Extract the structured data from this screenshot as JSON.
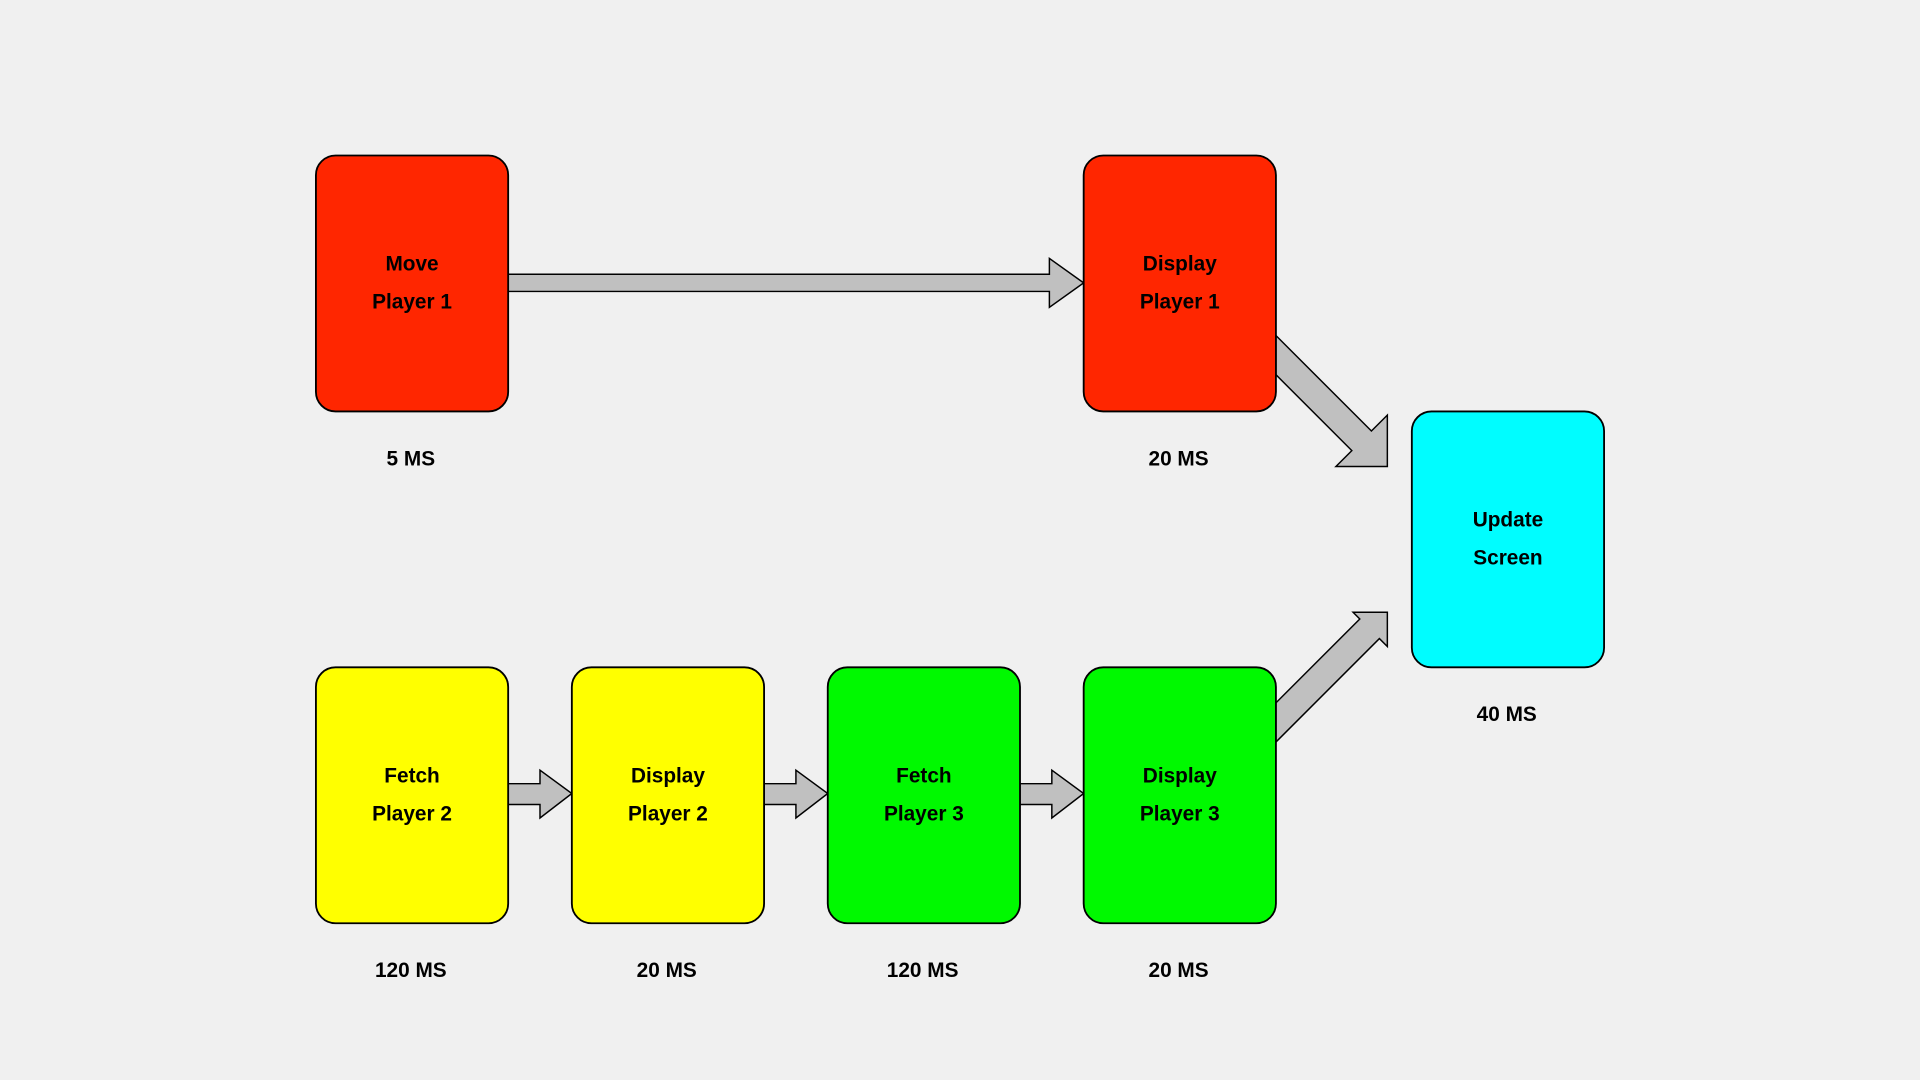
{
  "nodes": [
    {
      "id": "move-player-1",
      "lines": [
        "Move",
        "Player 1"
      ],
      "time": "5 MS",
      "color": "#ff2600"
    },
    {
      "id": "display-player-1",
      "lines": [
        "Display",
        "Player 1"
      ],
      "time": "20 MS",
      "color": "#ff2600"
    },
    {
      "id": "fetch-player-2",
      "lines": [
        "Fetch",
        "Player 2"
      ],
      "time": "120 MS",
      "color": "#ffff00"
    },
    {
      "id": "display-player-2",
      "lines": [
        "Display",
        "Player 2"
      ],
      "time": "20 MS",
      "color": "#ffff00"
    },
    {
      "id": "fetch-player-3",
      "lines": [
        "Fetch",
        "Player 3"
      ],
      "time": "120 MS",
      "color": "#00f900"
    },
    {
      "id": "display-player-3",
      "lines": [
        "Display",
        "Player 3"
      ],
      "time": "20 MS",
      "color": "#00f900"
    },
    {
      "id": "update-screen",
      "lines": [
        "Update",
        "Screen"
      ],
      "time": "40 MS",
      "color": "#00fdff"
    }
  ],
  "edges": [
    {
      "from": "move-player-1",
      "to": "display-player-1"
    },
    {
      "from": "fetch-player-2",
      "to": "display-player-2"
    },
    {
      "from": "display-player-2",
      "to": "fetch-player-3"
    },
    {
      "from": "fetch-player-3",
      "to": "display-player-3"
    },
    {
      "from": "display-player-1",
      "to": "update-screen"
    },
    {
      "from": "display-player-3",
      "to": "update-screen"
    }
  ],
  "colors": {
    "background": "#f0f0f0",
    "arrow": "#c0c0c0"
  }
}
